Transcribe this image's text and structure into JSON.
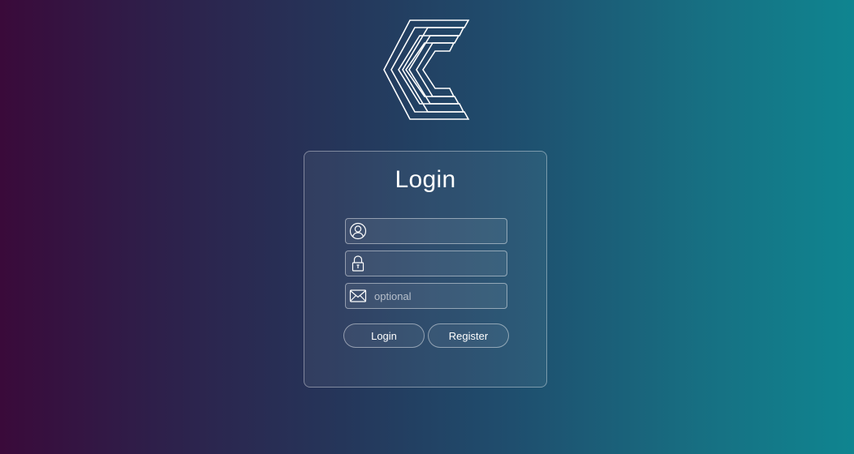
{
  "logo": {
    "icon": "stacked-chevron-c-logo"
  },
  "login_card": {
    "title": "Login",
    "username": {
      "icon": "user-icon",
      "value": "",
      "placeholder": ""
    },
    "password": {
      "icon": "lock-icon",
      "value": "",
      "placeholder": ""
    },
    "email": {
      "icon": "envelope-icon",
      "value": "",
      "placeholder": "optional"
    },
    "login_button_label": "Login",
    "register_button_label": "Register"
  },
  "colors": {
    "background_left": "#3a0a3a",
    "background_right": "#0f8590",
    "foreground": "#ffffff"
  }
}
